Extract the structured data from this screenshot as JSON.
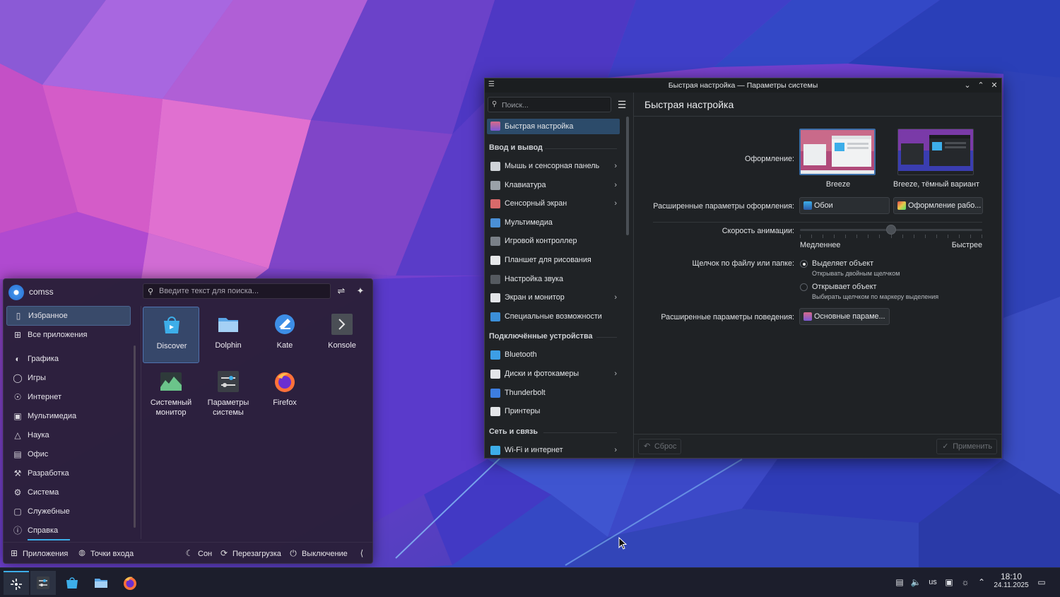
{
  "launcher": {
    "user": "comss",
    "search_placeholder": "Введите текст для поиска...",
    "categories": [
      {
        "label": "Избранное",
        "icon": "bookmark-icon",
        "active": true
      },
      {
        "label": "Все приложения",
        "icon": "grid-icon"
      },
      {
        "label": "Графика",
        "icon": "graphics-icon"
      },
      {
        "label": "Игры",
        "icon": "gamepad-icon"
      },
      {
        "label": "Интернет",
        "icon": "globe-icon"
      },
      {
        "label": "Мультимедиа",
        "icon": "monitor-icon"
      },
      {
        "label": "Наука",
        "icon": "flask-icon"
      },
      {
        "label": "Офис",
        "icon": "document-icon"
      },
      {
        "label": "Разработка",
        "icon": "hammer-icon"
      },
      {
        "label": "Система",
        "icon": "gear-icon"
      },
      {
        "label": "Служебные",
        "icon": "toolbox-icon"
      },
      {
        "label": "Справка",
        "icon": "info-icon"
      }
    ],
    "apps": [
      {
        "label": "Discover",
        "icon": "discover-icon"
      },
      {
        "label": "Dolphin",
        "icon": "folder-icon"
      },
      {
        "label": "Kate",
        "icon": "kate-icon"
      },
      {
        "label": "Konsole",
        "icon": "terminal-icon"
      },
      {
        "label": "Системный монитор",
        "icon": "system-monitor-icon"
      },
      {
        "label": "Параметры системы",
        "icon": "system-settings-icon"
      },
      {
        "label": "Firefox",
        "icon": "firefox-icon"
      }
    ],
    "footer": {
      "apps": "Приложения",
      "places": "Точки входа",
      "sleep": "Сон",
      "restart": "Перезагрузка",
      "shutdown": "Выключение"
    }
  },
  "settings": {
    "window_title": "Быстрая настройка — Параметры системы",
    "search_placeholder": "Поиск...",
    "page_title": "Быстрая настройка",
    "sidebar": {
      "top_item": "Быстрая настройка",
      "group1": "Ввод и вывод",
      "group1_items": [
        {
          "label": "Мышь и сенсорная панель",
          "arrow": true,
          "color": "#cfd3d8"
        },
        {
          "label": "Клавиатура",
          "arrow": true,
          "color": "#9aa1a8"
        },
        {
          "label": "Сенсорный экран",
          "arrow": true,
          "color": "#d86a6a"
        },
        {
          "label": "Мультимедиа",
          "arrow": false,
          "color": "#4a8fd6"
        },
        {
          "label": "Игровой контроллер",
          "arrow": false,
          "color": "#7a8088"
        },
        {
          "label": "Планшет для рисования",
          "arrow": false,
          "color": "#e6e8ea"
        },
        {
          "label": "Настройка звука",
          "arrow": false,
          "color": "#555a60"
        },
        {
          "label": "Экран и монитор",
          "arrow": true,
          "color": "#e3e5e8"
        },
        {
          "label": "Специальные возможности",
          "arrow": false,
          "color": "#3b8fd8"
        }
      ],
      "group2": "Подключённые устройства",
      "group2_items": [
        {
          "label": "Bluetooth",
          "arrow": false,
          "color": "#3d9ee6"
        },
        {
          "label": "Диски и фотокамеры",
          "arrow": true,
          "color": "#e3e5e8"
        },
        {
          "label": "Thunderbolt",
          "arrow": false,
          "color": "#3d7ee0"
        },
        {
          "label": "Принтеры",
          "arrow": false,
          "color": "#e3e5e8"
        }
      ],
      "group3": "Сеть и связь",
      "group3_items": [
        {
          "label": "Wi-Fi и интернет",
          "arrow": true,
          "color": "#3daee9"
        }
      ]
    },
    "appearance_label": "Оформление:",
    "theme_light": "Breeze",
    "theme_dark": "Breeze, тёмный вариант",
    "advanced_appearance_label": "Расширенные параметры оформления:",
    "wallpaper_button": "Обои",
    "workspace_button": "Оформление рабо...",
    "animation_label": "Скорость анимации:",
    "animation_slow": "Медленнее",
    "animation_fast": "Быстрее",
    "animation_level": 0.5,
    "click_label": "Щелчок по файлу или папке:",
    "click_option1": "Выделяет объект",
    "click_option1_hint": "Открывать двойным щелчком",
    "click_option2": "Открывает объект",
    "click_option2_hint": "Выбирать щелчком по маркеру выделения",
    "advanced_behavior_label": "Расширенные параметры поведения:",
    "behavior_button": "Основные параме...",
    "reset_button": "Сброс",
    "apply_button": "Применить"
  },
  "taskbar": {
    "keyboard_layout": "us",
    "time": "18:10",
    "date": "24.11.2025"
  },
  "colors": {
    "accent": "#3daee9",
    "selection": "#2c4b6a"
  }
}
